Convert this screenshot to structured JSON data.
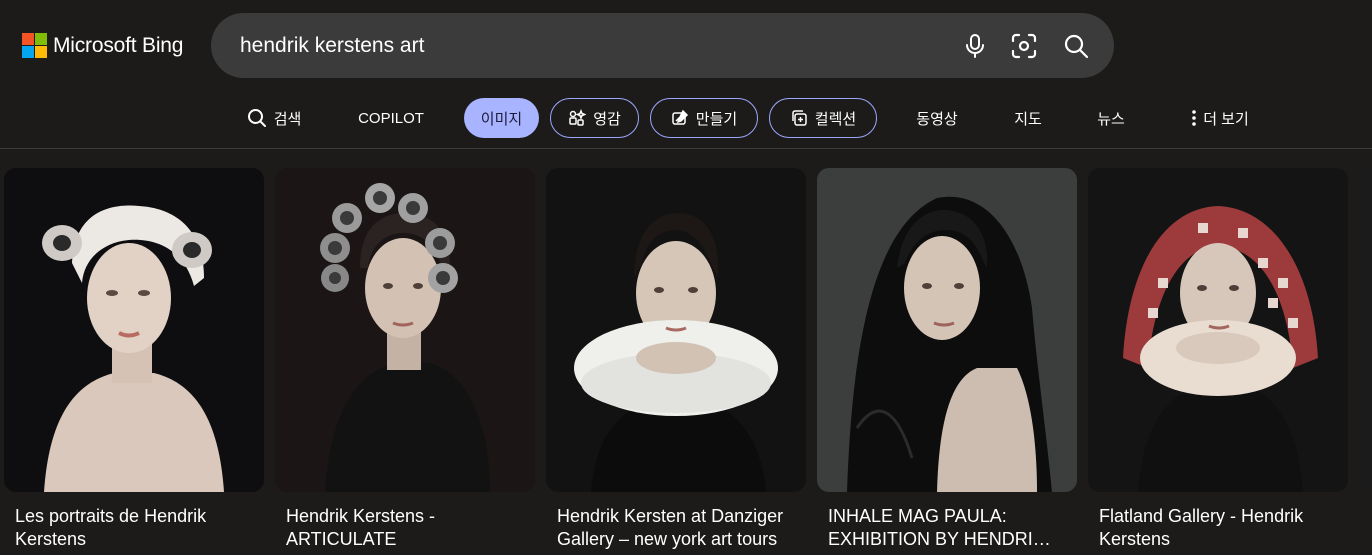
{
  "brand": {
    "name": "Microsoft Bing",
    "logo_colors": [
      "#f35325",
      "#81bc06",
      "#05a6f0",
      "#ffba08"
    ]
  },
  "search": {
    "query": "hendrik kerstens art",
    "icons": [
      "microphone-icon",
      "visual-search-icon",
      "search-icon"
    ]
  },
  "nav": {
    "items": [
      {
        "label": "검색",
        "icon": "search-icon"
      },
      {
        "label": "COPILOT"
      },
      {
        "label": "이미지",
        "active": true
      },
      {
        "label": "영감",
        "icon": "inspiration-icon"
      },
      {
        "label": "만들기",
        "icon": "create-icon"
      },
      {
        "label": "컬렉션",
        "icon": "collections-icon"
      },
      {
        "label": "동영상"
      },
      {
        "label": "지도"
      },
      {
        "label": "뉴스"
      },
      {
        "label": "더 보기",
        "icon": "more-vertical-icon"
      }
    ]
  },
  "colors": {
    "background": "#1c1b1a",
    "search_box": "#3b3b3b",
    "accent": "#a8b4ff"
  },
  "results": [
    {
      "caption": "Les portraits de Hendrik Kerstens",
      "subject": "white towel turban with cans"
    },
    {
      "caption": "Hendrik Kerstens - ARTICULATE",
      "subject": "soda can hair rollers"
    },
    {
      "caption": "Hendrik Kersten at Danziger Gallery – new york art tours",
      "subject": "paper doily ruff collar"
    },
    {
      "caption": "INHALE MAG PAULA: EXHIBITION BY HENDRI…",
      "subject": "black plastic bag hood"
    },
    {
      "caption": "Flatland Gallery - Hendrik Kerstens",
      "subject": "checkered cloth headscarf with ruff"
    }
  ]
}
